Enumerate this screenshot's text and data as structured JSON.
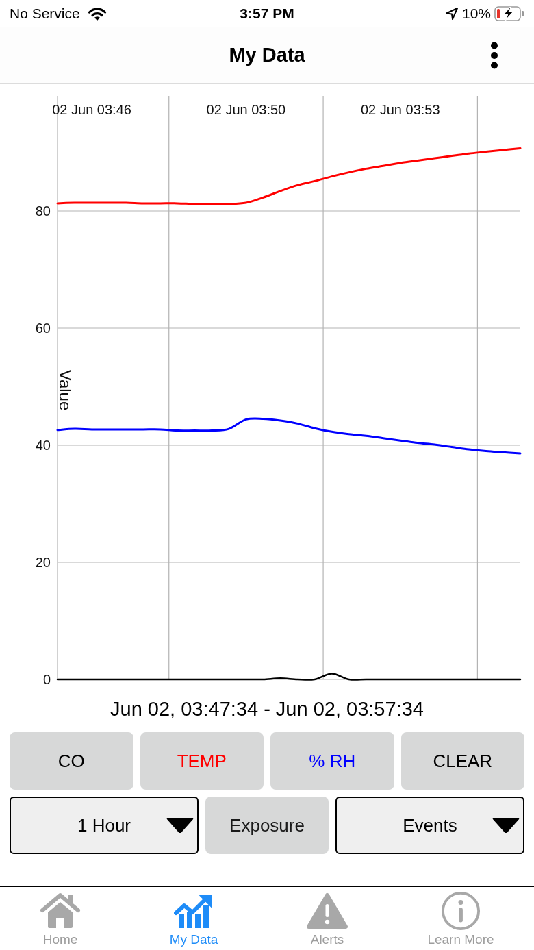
{
  "status_bar": {
    "carrier": "No Service",
    "time": "3:57 PM",
    "battery": "10%"
  },
  "nav_bar": {
    "title": "My Data"
  },
  "chart": {
    "chart_data": {
      "type": "line",
      "ylabel": "Value",
      "grid": true,
      "categories": [
        null,
        null,
        "02 Jun 03:46",
        null,
        null,
        null,
        null,
        null,
        null,
        null,
        null,
        "02 Jun 03:50",
        null,
        null,
        null,
        null,
        null,
        null,
        null,
        null,
        "02 Jun 03:53",
        null,
        null,
        null,
        null,
        null,
        null,
        null
      ],
      "ylim": [
        0,
        100
      ],
      "yticks": [
        0,
        20,
        40,
        60,
        80
      ],
      "series": [
        {
          "color": "#000000",
          "values": [
            0,
            0,
            0,
            0,
            0,
            0,
            0,
            0,
            0,
            0,
            0,
            0,
            0,
            0.2,
            0,
            0,
            1.0,
            0,
            0,
            0,
            0,
            0,
            0,
            0,
            0,
            0,
            0,
            0
          ]
        },
        {
          "color": "#ff0000",
          "values": [
            81.3,
            81.4,
            81.4,
            81.4,
            81.4,
            81.3,
            81.3,
            81.3,
            81.2,
            81.2,
            81.2,
            81.4,
            82.3,
            83.4,
            84.4,
            85.1,
            85.9,
            86.6,
            87.2,
            87.7,
            88.2,
            88.6,
            89.0,
            89.4,
            89.8,
            90.1,
            90.4,
            90.7
          ]
        },
        {
          "color": "#0000ff",
          "values": [
            42.6,
            42.8,
            42.7,
            42.7,
            42.7,
            42.7,
            42.7,
            42.5,
            42.5,
            42.5,
            42.8,
            44.4,
            44.5,
            44.2,
            43.7,
            42.9,
            42.3,
            41.9,
            41.6,
            41.2,
            40.8,
            40.4,
            40.1,
            39.7,
            39.3,
            39.0,
            38.8,
            38.6
          ]
        }
      ]
    }
  },
  "time_range": "Jun 02, 03:47:34 - Jun 02, 03:57:34",
  "series_buttons": [
    {
      "label": "CO",
      "color": "#000000"
    },
    {
      "label": "TEMP",
      "color": "#ff0000"
    },
    {
      "label": "% RH",
      "color": "#0000ff"
    },
    {
      "label": "CLEAR",
      "color": "#000000"
    }
  ],
  "controls": [
    {
      "kind": "dropdown",
      "label": "1 Hour"
    },
    {
      "kind": "button",
      "label": "Exposure"
    },
    {
      "kind": "dropdown",
      "label": "Events"
    }
  ],
  "tab_bar": [
    {
      "label": "Home",
      "selected": false
    },
    {
      "label": "My Data",
      "selected": true
    },
    {
      "label": "Alerts",
      "selected": false
    },
    {
      "label": "Learn More",
      "selected": false
    }
  ]
}
